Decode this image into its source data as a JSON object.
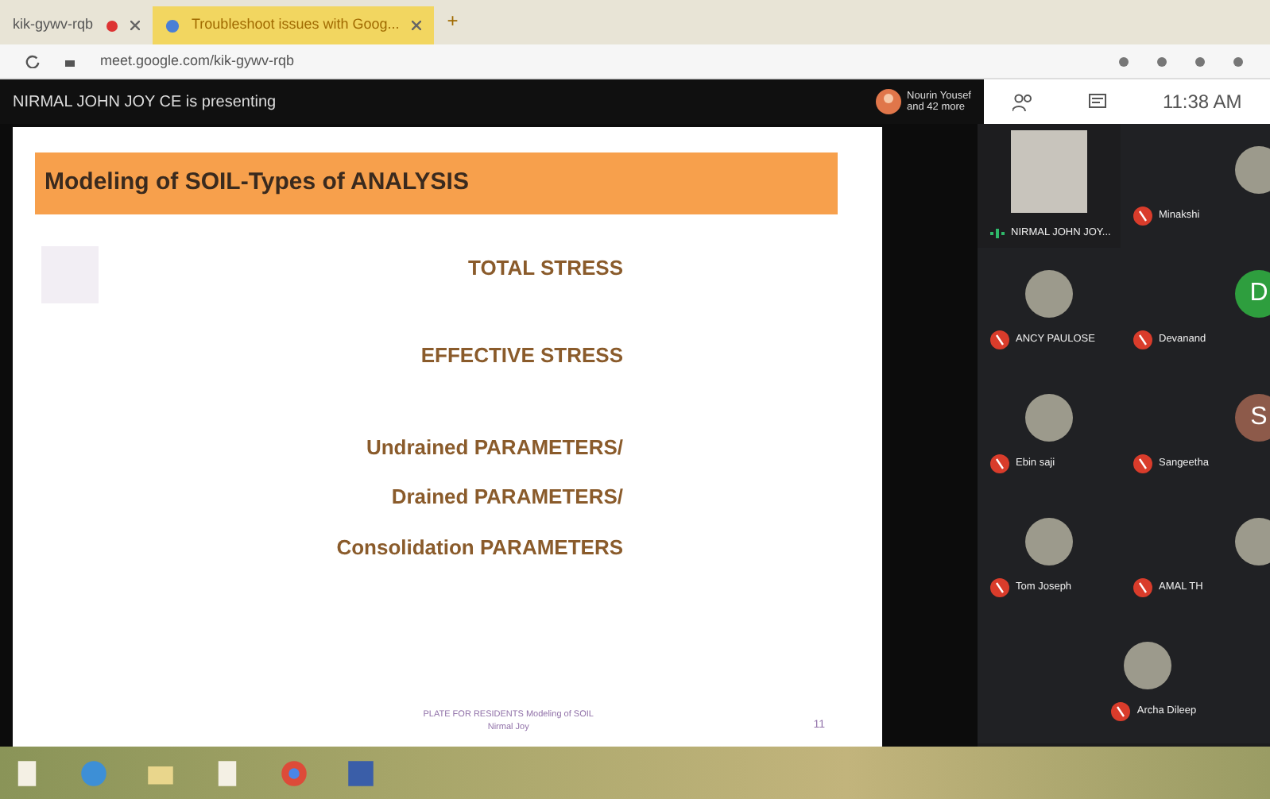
{
  "browser": {
    "tabs": [
      {
        "title": "kik-gywv-rqb",
        "selected": false,
        "recording": true
      },
      {
        "title": "Troubleshoot issues with Goog...",
        "selected": true,
        "recording": false
      }
    ],
    "new_tab": "+",
    "url": "meet.google.com/kik-gywv-rqb"
  },
  "meet": {
    "presenter_banner": "NIRMAL JOHN JOY CE is presenting",
    "participants_summary": {
      "name": "Nourin Yousef",
      "others": "and 42 more"
    },
    "clock": "11:38 AM"
  },
  "slide": {
    "title": "Modeling of SOIL-Types of ANALYSIS",
    "items": [
      "TOTAL STRESS",
      "EFFECTIVE STRESS",
      "Undrained PARAMETERS/",
      "Drained PARAMETERS/",
      "Consolidation PARAMETERS"
    ],
    "footer": "PLATE FOR RESIDENTS Modeling of SOIL",
    "footer_line_2": "Nirmal Joy",
    "page_number": "11"
  },
  "participants": [
    {
      "name": "NIRMAL JOHN JOY...",
      "kind": "video",
      "muted": false
    },
    {
      "name": "Minakshi",
      "kind": "photo",
      "muted": true
    },
    {
      "name": "ANCY PAULOSE",
      "kind": "photo",
      "muted": true
    },
    {
      "name": "Devanand",
      "kind": "letter",
      "letter": "D",
      "color": "#2e9e3e",
      "muted": true
    },
    {
      "name": "Ebin saji",
      "kind": "photo",
      "muted": true
    },
    {
      "name": "Sangeetha",
      "kind": "letter",
      "letter": "S",
      "color": "#8d5a4a",
      "muted": true
    },
    {
      "name": "Tom Joseph",
      "kind": "photo",
      "muted": true
    },
    {
      "name": "AMAL TH",
      "kind": "photo",
      "muted": true
    },
    {
      "name": "Archa Dileep",
      "kind": "photo",
      "muted": true
    }
  ]
}
